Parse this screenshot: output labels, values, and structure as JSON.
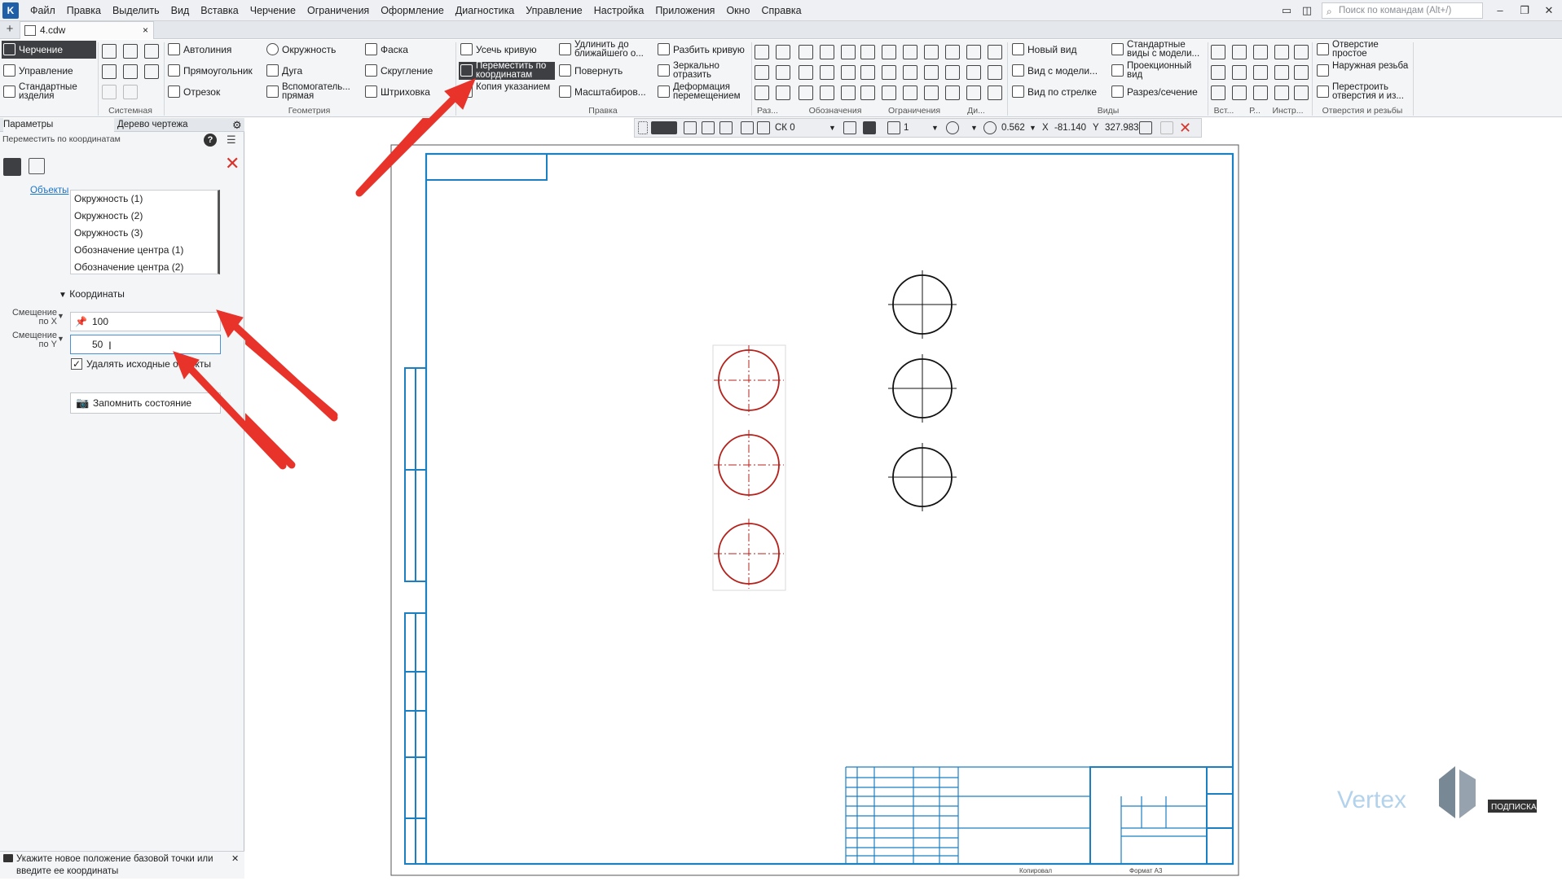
{
  "app": {
    "menu": [
      "Файл",
      "Правка",
      "Выделить",
      "Вид",
      "Вставка",
      "Черчение",
      "Ограничения",
      "Оформление",
      "Диагностика",
      "Управление",
      "Настройка",
      "Приложения",
      "Окно",
      "Справка"
    ],
    "search_placeholder": "Поиск по командам (Alt+/)"
  },
  "tab": {
    "name": "4.cdw",
    "close": "×"
  },
  "modes": {
    "drawing": "Черчение",
    "manage": "Управление",
    "standard": "Стандартные изделия"
  },
  "ribbon": {
    "groups": {
      "system": "Системная",
      "geometry": "Геометрия",
      "edit": "Правка",
      "raz": "Раз...",
      "marks": "Обозначения",
      "constraints": "Ограничения",
      "di": "Ди...",
      "views": "Виды",
      "vst": "Вст...",
      "r": "Р...",
      "instr": "Инстр...",
      "holes": "Отверстия и резьбы"
    },
    "geometry": {
      "autoline": "Автолиния",
      "rectangle": "Прямоугольник",
      "segment": "Отрезок",
      "circle": "Окружность",
      "arc": "Дуга",
      "aux_line": "Вспомогатель... прямая",
      "chamfer": "Фаска",
      "fillet": "Скругление",
      "hatch": "Штриховка"
    },
    "edit": {
      "trim": "Усечь кривую",
      "move_coords": "Переместить по координатам",
      "copy": "Копия указанием",
      "extend": "Удлинить до ближайшего о...",
      "rotate": "Повернуть",
      "scale": "Масштабиров...",
      "split": "Разбить кривую",
      "mirror": "Зеркально отразить",
      "deform": "Деформация перемещением"
    },
    "views": {
      "new_view": "Новый вид",
      "from_model": "Вид с модели...",
      "by_arrow": "Вид по стрелке",
      "standard_views": "Стандартные виды с модели...",
      "projection": "Проекционный вид",
      "section": "Разрез/сечение"
    },
    "holes": {
      "simple": "Отверстие простое",
      "thread": "Наружная резьба",
      "rebuild": "Перестроить отверстия и из..."
    }
  },
  "left_tabs": {
    "params": "Параметры",
    "tree": "Дерево чертежа"
  },
  "panel": {
    "command": "Переместить по координатам",
    "objects_label": "Объекты",
    "objects": [
      "Окружность (1)",
      "Окружность (2)",
      "Окружность (3)",
      "Обозначение центра (1)",
      "Обозначение центра (2)"
    ],
    "coords_header": "Координаты",
    "offset_x_label": "Смещение по X",
    "offset_y_label": "Смещение по Y",
    "offset_x": "100",
    "offset_y": "50",
    "delete_source": "Удалять исходные объекты",
    "delete_source_checked": true,
    "remember": "Запомнить состояние"
  },
  "status": {
    "hint": "Укажите новое положение базовой точки или введите ее координаты"
  },
  "coordbar": {
    "cs": "СК 0",
    "layer": "1",
    "zoom": "0.562",
    "x_label": "X",
    "x": "-81.140",
    "y_label": "Y",
    "y": "327.983"
  },
  "drawing": {
    "watermark": "Vertex",
    "sub": "ПОДПИСКА",
    "copied": "Копировал",
    "format": "Формат   А3"
  },
  "colors": {
    "frame": "#1b7fc4",
    "circle_selected": "#b5201a",
    "arrow": "#e8332a"
  }
}
